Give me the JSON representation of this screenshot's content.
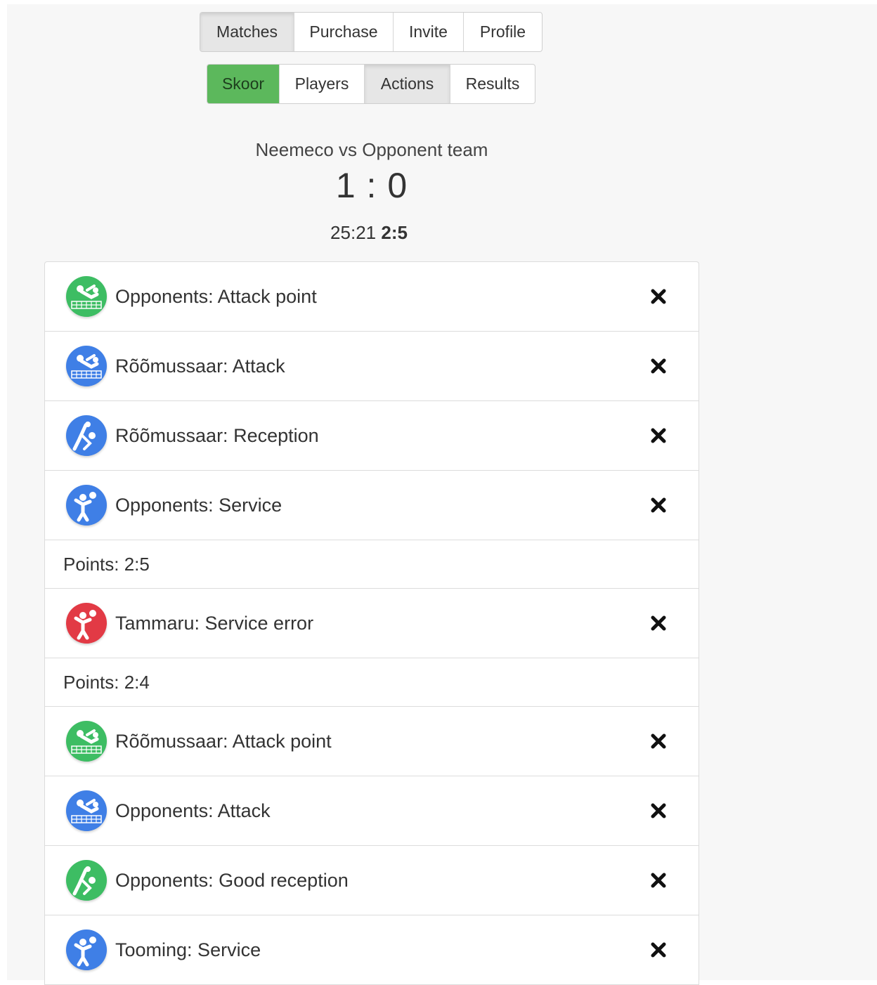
{
  "nav": {
    "main": [
      {
        "label": "Matches",
        "active": true
      },
      {
        "label": "Purchase",
        "active": false
      },
      {
        "label": "Invite",
        "active": false
      },
      {
        "label": "Profile",
        "active": false
      }
    ],
    "sub": [
      {
        "label": "Skoor",
        "active": true
      },
      {
        "label": "Players",
        "active": false
      },
      {
        "label": "Actions",
        "active": true
      },
      {
        "label": "Results",
        "active": false
      }
    ]
  },
  "match": {
    "title": "Neemeco vs Opponent team",
    "score": "1 : 0",
    "set_score": "25:21",
    "current_set": "2:5"
  },
  "colors": {
    "green": "#3dbd63",
    "blue": "#3f7fe6",
    "red": "#e23a45",
    "active_green": "#5cb85c"
  },
  "events": [
    {
      "type": "action",
      "text": "Opponents: Attack point",
      "icon": "attack-icon",
      "color": "green"
    },
    {
      "type": "action",
      "text": "Rõõmussaar: Attack",
      "icon": "attack-icon",
      "color": "blue"
    },
    {
      "type": "action",
      "text": "Rõõmussaar: Reception",
      "icon": "reception-icon",
      "color": "blue"
    },
    {
      "type": "action",
      "text": "Opponents: Service",
      "icon": "service-icon",
      "color": "blue"
    },
    {
      "type": "points",
      "text": "Points: 2:5"
    },
    {
      "type": "action",
      "text": "Tammaru: Service error",
      "icon": "service-icon",
      "color": "red"
    },
    {
      "type": "points",
      "text": "Points: 2:4"
    },
    {
      "type": "action",
      "text": "Rõõmussaar: Attack point",
      "icon": "attack-icon",
      "color": "green"
    },
    {
      "type": "action",
      "text": "Opponents: Attack",
      "icon": "attack-icon",
      "color": "blue"
    },
    {
      "type": "action",
      "text": "Opponents: Good reception",
      "icon": "reception-icon",
      "color": "green"
    },
    {
      "type": "action",
      "text": "Tooming: Service",
      "icon": "service-icon",
      "color": "blue"
    }
  ]
}
